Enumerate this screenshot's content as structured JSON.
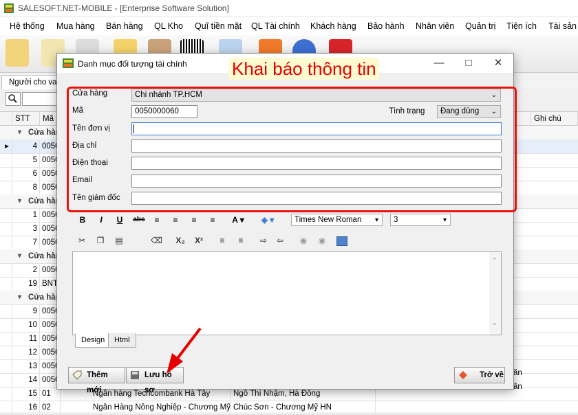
{
  "app": {
    "title": "SALESOFT.NET-MOBILE - [Enterprise Software Solution]"
  },
  "menu": [
    "Hệ thống",
    "Mua hàng",
    "Bán hàng",
    "QL Kho",
    "Quĩ tiền mặt",
    "QL Tài chính",
    "Khách hàng",
    "Bảo hành",
    "Nhân viên",
    "Quản trị",
    "Tiện ích",
    "Tài sản"
  ],
  "tab": {
    "label": "Người cho vay"
  },
  "grid": {
    "headers": {
      "stt": "STT",
      "ma": "Mã đ",
      "ghichu": "Ghi chú"
    },
    "group_label": "Cửa hàn",
    "rows": [
      {
        "stt": "4",
        "ma": "0050"
      },
      {
        "stt": "5",
        "ma": "0050"
      },
      {
        "stt": "6",
        "ma": "0050"
      },
      {
        "stt": "8",
        "ma": "0050"
      },
      {
        "stt": "1",
        "ma": "0050"
      },
      {
        "stt": "3",
        "ma": "0050"
      },
      {
        "stt": "7",
        "ma": "0050"
      },
      {
        "stt": "2",
        "ma": "0050"
      },
      {
        "stt": "19",
        "ma": "BNTI"
      },
      {
        "stt": "9",
        "ma": "0050"
      },
      {
        "stt": "10",
        "ma": "0050"
      },
      {
        "stt": "11",
        "ma": "0050"
      },
      {
        "stt": "12",
        "ma": "0050"
      },
      {
        "stt": "13",
        "ma": "0050"
      },
      {
        "stt": "14",
        "ma": "0050"
      }
    ],
    "bottom_rows": [
      {
        "stt": "15",
        "ma": "01",
        "ten": "Ngân hàng Techcombank Hà Tây",
        "dc": "Ngô Thì Nhậm, Hà Đông"
      },
      {
        "stt": "16",
        "ma": "02",
        "ten": "Ngân Hàng Nông Nghiệp - Chương Mỹ",
        "dc": "Chúc Sơn - Chương Mỹ HN"
      }
    ],
    "right_fragments": [
      "ăn",
      "ăn"
    ]
  },
  "dialog": {
    "title": "Danh mục đối tượng tài chính",
    "annotation": "Khai báo thông tin",
    "fields": {
      "cua_hang": {
        "label": "Cửa hàng",
        "value": "Chi nhánh TP.HCM"
      },
      "ma": {
        "label": "Mã",
        "value": "0050000060"
      },
      "tinh_trang": {
        "label": "Tình trạng",
        "value": "Đang dùng"
      },
      "ten_don_vi": {
        "label": "Tên đơn vị",
        "value": ""
      },
      "dia_chi": {
        "label": "Địa chỉ",
        "value": ""
      },
      "dien_thoai": {
        "label": "Điện thoại",
        "value": ""
      },
      "email": {
        "label": "Email",
        "value": ""
      },
      "ten_giam_doc": {
        "label": "Tên giám đốc",
        "value": ""
      }
    },
    "editor": {
      "font": "Times New Roman",
      "size": "3",
      "tabs": [
        "Design",
        "Html"
      ]
    },
    "buttons": {
      "them_moi": "Thêm mới",
      "luu_ho_so": "Lưu hồ sơ",
      "tro_ve": "Trở về"
    }
  },
  "colors": {
    "annotation_red": "#e8120c",
    "arrow_red": "#e60000"
  }
}
